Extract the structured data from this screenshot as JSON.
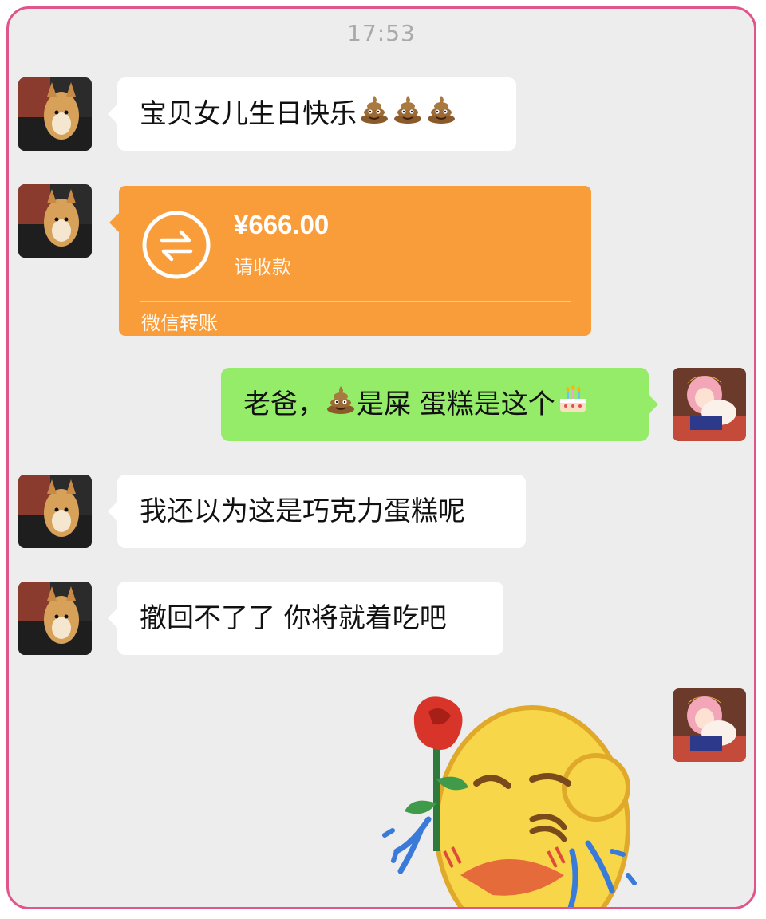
{
  "status": {
    "time": "17:53"
  },
  "messages": [
    {
      "sender": "dad",
      "type": "text",
      "text": "宝贝女儿生日快乐",
      "emojis": [
        "poop-icon",
        "poop-icon",
        "poop-icon"
      ]
    },
    {
      "sender": "dad",
      "type": "transfer",
      "amount": "¥666.00",
      "status_text": "请收款",
      "label": "微信转账",
      "icon": "transfer-arrows-icon"
    },
    {
      "sender": "me",
      "type": "text",
      "text_before": "老爸，",
      "emoji_mid": "poop-icon",
      "text_after": "是屎 蛋糕是这个",
      "emoji_end": "birthday-cake-icon"
    },
    {
      "sender": "dad",
      "type": "text",
      "text": "我还以为这是巧克力蛋糕呢"
    },
    {
      "sender": "dad",
      "type": "text",
      "text": "撤回不了了 你将就着吃吧"
    },
    {
      "sender": "me",
      "type": "sticker",
      "sticker": "crying-face-with-rose-sticker"
    }
  ],
  "colors": {
    "background": "#ededed",
    "incoming_bubble": "#ffffff",
    "outgoing_bubble": "#95ec69",
    "transfer_card": "#f99d3b",
    "frame_border": "#e0558a"
  }
}
